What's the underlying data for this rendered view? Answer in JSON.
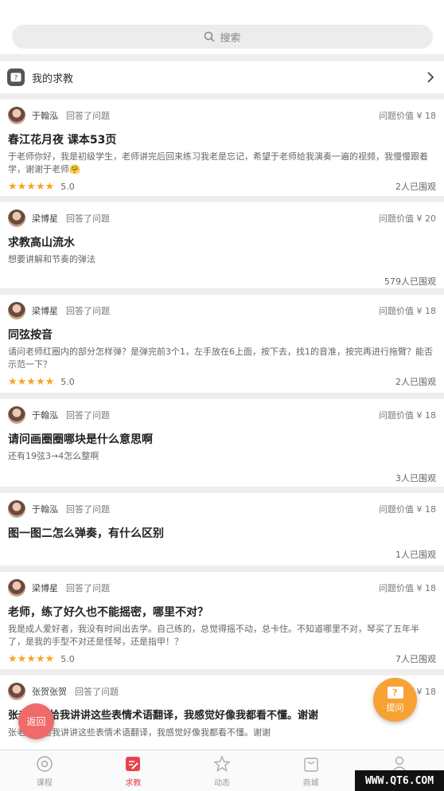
{
  "search": {
    "placeholder": "搜索"
  },
  "my_help": {
    "label": "我的求教",
    "icon_text": "?"
  },
  "cards": [
    {
      "user": "于翰泓",
      "action": "回答了问题",
      "value": "问题价值 ¥ 18",
      "title": "春江花月夜   课本53页",
      "body": "于老师你好，我是初级学生，老师讲完后回来练习我老是忘记，希望于老师给我演奏一遍的视频，我慢慢跟着学，谢谢于老师🤗",
      "stars": "★★★★★",
      "score": "5.0",
      "views": "2人已围观"
    },
    {
      "user": "梁博星",
      "action": "回答了问题",
      "value": "问题价值 ¥ 20",
      "title": "求教高山流水",
      "body": " 想要讲解和节奏的弹法",
      "stars": "",
      "score": "",
      "views": "579人已围观"
    },
    {
      "user": "梁博星",
      "action": "回答了问题",
      "value": "问题价值 ¥ 18",
      "title": "同弦按音",
      "body": "请问老师红圈内的部分怎样弹？是弹完前3个1，左手放在6上面，按下去，找1的音准，按完再进行拖臂？能否示范一下？",
      "stars": "★★★★★",
      "score": "5.0",
      "views": "2人已围观"
    },
    {
      "user": "于翰泓",
      "action": "回答了问题",
      "value": "问题价值 ¥ 18",
      "title": "请问画圈圈哪块是什么意思啊",
      "body": "还有19弦3→4怎么整啊",
      "stars": "",
      "score": "",
      "views": "3人已围观"
    },
    {
      "user": "于翰泓",
      "action": "回答了问题",
      "value": "问题价值 ¥ 18",
      "title": "图一图二怎么弹奏，有什么区别",
      "body": "",
      "stars": "",
      "score": "",
      "views": "1人已围观"
    },
    {
      "user": "梁博星",
      "action": "回答了问题",
      "value": "问题价值 ¥ 18",
      "title": "老师，练了好久也不能摇密，哪里不对？",
      "body": "我是成人爱好者，我没有时间出去学。自己练的，总觉得摇不动，总卡住。不知道哪里不对，琴买了五年半了，是我的手型不对还是怪琴，还是指甲！？",
      "stars": "★★★★★",
      "score": "5.0",
      "views": "7人已围观"
    },
    {
      "user": "张贺张贺",
      "action": "回答了问题",
      "value": "问题价值 ¥ 18",
      "title": "张老师你给我讲讲这些表情术语翻译，我感觉好像我都看不懂。谢谢",
      "body": "张老师你给我讲讲这些表情术语翻译，我感觉好像我都看不懂。谢谢",
      "stars": "",
      "score": "",
      "views": ""
    }
  ],
  "floating": {
    "back": "返回",
    "ask": "提问",
    "ask_icon": "?"
  },
  "tabs": [
    {
      "label": "课程",
      "icon": "disc-icon"
    },
    {
      "label": "求教",
      "icon": "edit-icon"
    },
    {
      "label": "动态",
      "icon": "star-icon"
    },
    {
      "label": "商城",
      "icon": "bag-icon"
    },
    {
      "label": "我的",
      "icon": "user-icon"
    }
  ],
  "watermark": "WWW.QT6.COM",
  "colors": {
    "accent": "#e8424b",
    "star": "#f5a623",
    "ask": "#f7a233",
    "back": "#f06a6a"
  }
}
